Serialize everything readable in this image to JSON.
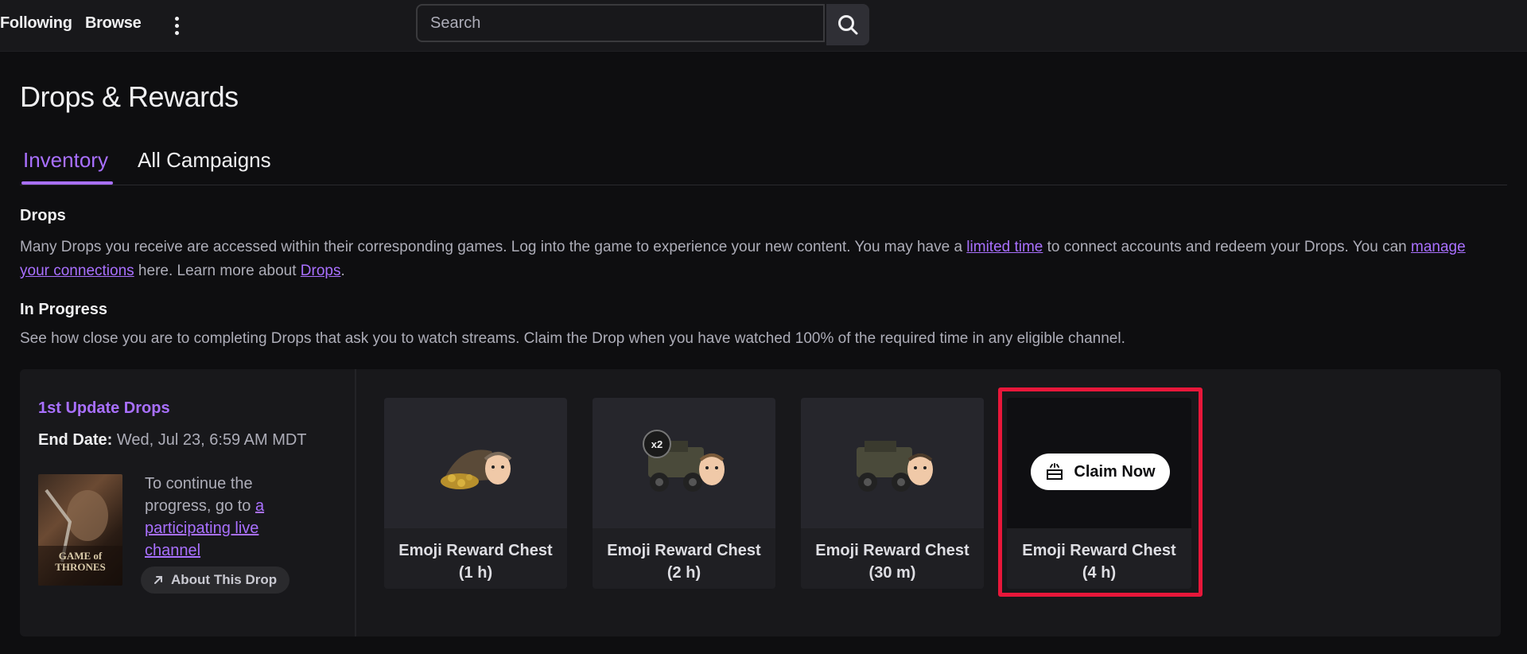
{
  "topbar": {
    "following_label": "Following",
    "browse_label": "Browse",
    "search_placeholder": "Search"
  },
  "page": {
    "title": "Drops & Rewards",
    "tabs": [
      {
        "label": "Inventory",
        "active": true
      },
      {
        "label": "All Campaigns",
        "active": false
      }
    ]
  },
  "drops_section": {
    "heading": "Drops",
    "text_1": "Many Drops you receive are accessed within their corresponding games. Log into the game to experience your new content. You may have a ",
    "link_limited_time": "limited time",
    "text_2": " to connect accounts and redeem your Drops. You can ",
    "link_manage_connections": "manage your connections",
    "text_3": " here. Learn more about ",
    "link_drops": "Drops",
    "text_4": "."
  },
  "in_progress": {
    "heading": "In Progress",
    "text": "See how close you are to completing Drops that ask you to watch streams. Claim the Drop when you have watched 100% of the required time in any eligible channel."
  },
  "campaign": {
    "name": "1st Update Drops",
    "end_date_label": "End Date:",
    "end_date_value": " Wed, Jul 23, 6:59 AM MDT",
    "game_art_text": "GAME of THRONES",
    "continue_text": "To continue the progress, go to ",
    "continue_link": "a participating live channel",
    "about_label": "About This Drop",
    "drops": [
      {
        "label_line1": "Emoji Reward Chest",
        "label_line2": "(1 h)",
        "icon": "treasure-pile-icon"
      },
      {
        "label_line1": "Emoji Reward Chest",
        "label_line2": "(2 h)",
        "icon": "vehicle-icon",
        "badge": "x2"
      },
      {
        "label_line1": "Emoji Reward Chest",
        "label_line2": "(30 m)",
        "icon": "vehicle-icon"
      },
      {
        "label_line1": "Emoji Reward Chest",
        "label_line2": "(4 h)",
        "claim_label": "Claim Now",
        "claimable": true
      }
    ]
  },
  "colors": {
    "accent": "#a970ff",
    "highlight": "#e8173a",
    "background": "#0e0e10"
  }
}
